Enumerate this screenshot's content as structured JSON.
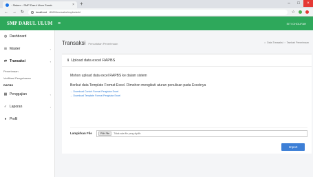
{
  "browser": {
    "tab_title": "· Sistem - SMP Darul Ulum Surab",
    "new_tab": "+",
    "address_host": "localhost",
    "address_path": ":8080/transaksi/rapbs/add",
    "colors": {
      "green_dot": "#4caf50",
      "red_dot": "#e53935"
    }
  },
  "header": {
    "brand": "SMP DARUL ULUM",
    "menu_icon": "≡",
    "user": "SITI CHOLIFAH",
    "color": "#2ea85b"
  },
  "sidebar": {
    "items": [
      {
        "icon": "dashboard-icon",
        "glyph": "◍",
        "label": "Dashboard"
      },
      {
        "icon": "master-icon",
        "glyph": "☰",
        "label": "Master",
        "caret": "‹"
      },
      {
        "icon": "transaksi-icon",
        "glyph": "⇄",
        "label": "Transaksi",
        "caret": "‹"
      },
      {
        "icon": "pengguna-icon",
        "glyph": "▦",
        "label": "Penggajian",
        "caret": "‹"
      },
      {
        "icon": "laporan-icon",
        "glyph": "✓",
        "label": "Laporan",
        "caret": "‹"
      },
      {
        "icon": "profil-icon",
        "glyph": "●",
        "label": "Profil"
      }
    ],
    "sub_items": [
      "Penerimaan",
      "Verifikasi Pengeluaran",
      "RAPBS"
    ]
  },
  "main": {
    "title": "Transaksi",
    "subtitle": "Pencatatan Penerimaan",
    "breadcrumb": [
      "Data Transaksi",
      "›",
      "Tambah Penerimaan"
    ],
    "card": {
      "heading": "Upload data excel RAPBS",
      "message": "Mohon upload data excel RAPBS ke dalam sistem",
      "instruction": "Berikut data Template Format Excel. Dimohon mengikuti aturan penulisan pada Excelnya",
      "links": [
        "→ Download Contoh Format Pengisian Excel",
        "→ Download Template Format Pengisian Excel"
      ],
      "file_label": "Lampirkan File",
      "file_button": "Pilih File",
      "file_none": "Tidak ada file yang dipilih",
      "import_label": "Import"
    }
  }
}
